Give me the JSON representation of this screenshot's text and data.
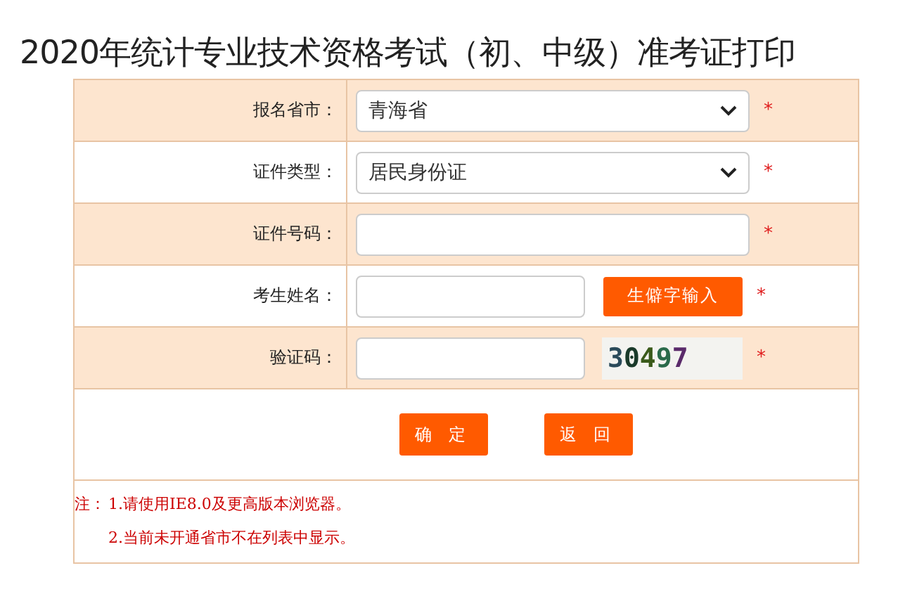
{
  "title": "2020年统计专业技术资格考试（初、中级）准考证打印",
  "rows": [
    {
      "label": "报名省市：",
      "kind": "select",
      "value": "青海省",
      "required_mark": "*"
    },
    {
      "label": "证件类型：",
      "kind": "select",
      "value": "居民身份证",
      "required_mark": "*"
    },
    {
      "label": "证件号码：",
      "kind": "input",
      "required_mark": "*"
    },
    {
      "label": "考生姓名：",
      "kind": "input_button",
      "button": "生僻字输入",
      "required_mark": "*"
    },
    {
      "label": "验证码：",
      "kind": "captcha",
      "captcha": "30497",
      "required_mark": "*"
    }
  ],
  "buttons": [
    "确 定",
    "返 回"
  ],
  "notes": [
    {
      "prefix": "注：",
      "text": "1.请使用IE8.0及更高版本浏览器。"
    },
    {
      "text": "2.当前未开通省市不在列表中显示。"
    }
  ]
}
